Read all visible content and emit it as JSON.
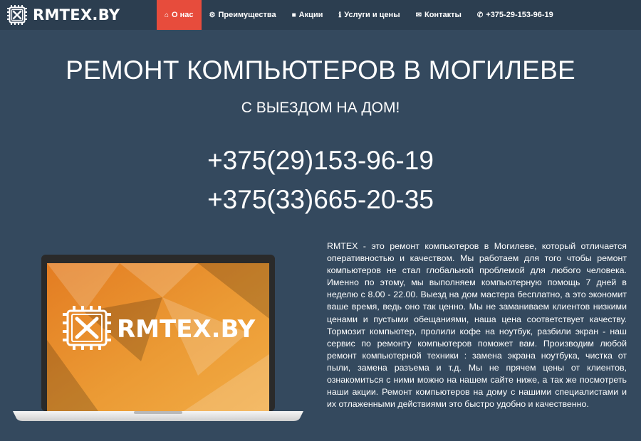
{
  "brand": {
    "name": "RMTEX.BY"
  },
  "nav": {
    "items": [
      {
        "label": "О нас",
        "icon": "home-icon",
        "active": true
      },
      {
        "label": "Преимущества",
        "icon": "cogs-icon",
        "active": false
      },
      {
        "label": "Акции",
        "icon": "puzzle-icon",
        "active": false
      },
      {
        "label": "Услуги и цены",
        "icon": "info-icon",
        "active": false
      },
      {
        "label": "Контакты",
        "icon": "envelope-icon",
        "active": false
      },
      {
        "label": "+375-29-153-96-19",
        "icon": "phone-icon",
        "active": false
      }
    ]
  },
  "hero": {
    "title": "РЕМОНТ КОМПЬЮТЕРОВ В МОГИЛЕВЕ",
    "subtitle": "С ВЫЕЗДОМ НА ДОМ!",
    "phone1": "+375(29)153-96-19",
    "phone2": "+375(33)665-20-35"
  },
  "laptop": {
    "screen_logo": "RMTEX.BY"
  },
  "description": " RMTEX - это ремонт компьютеров в Могилеве, который отличается оперативностью и качеством. Мы работаем для того чтобы ремонт компьютеров не стал глобальной проблемой для любого человека. Именно по этому, мы выполняем компьютерную помощь 7 дней в неделю с 8.00 - 22.00. Выезд на дом мастера бесплатно, а это экономит ваше время, ведь оно так ценно. Мы не заманиваем клиентов низкими ценами и пустыми обещаниями, наша цена соответствует качеству. Тормозит компьютер, пролили кофе на ноутбук, разбили экран - наш сервис по ремонту компьютеров поможет вам. Производим любой ремонт компьютерной техники : замена экрана ноутбука, чистка от пыли, замена разъема и т.д. Мы не прячем цены от клиентов, ознакомиться с ними можно на нашем сайте ниже, а так же посмотреть наши акции. Ремонт компьютеров на дому с нашими специалистами и их отлаженными действиями это быстро удобно и качественно.",
  "colors": {
    "background": "#34495e",
    "navbar": "#2c3e50",
    "active_nav": "#e74c3c",
    "screen_orange": "#e8902a"
  }
}
